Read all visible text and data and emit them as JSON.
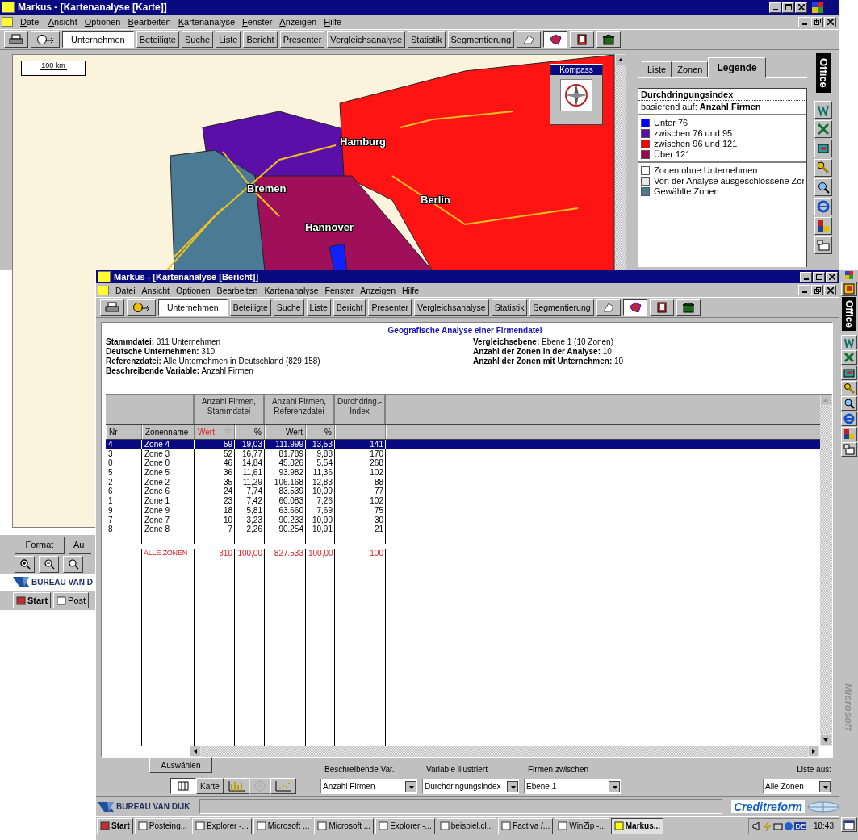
{
  "back_window": {
    "title": "Markus - [Kartenanalyse [Karte]]",
    "menu": [
      "Datei",
      "Ansicht",
      "Optionen",
      "Bearbeiten",
      "Kartenanalyse",
      "Fenster",
      "Anzeigen",
      "Hilfe"
    ],
    "toolbar": {
      "buttons": [
        {
          "label": "Unternehmen",
          "selected": true
        },
        {
          "label": "Beteiligte",
          "selected": false
        },
        {
          "label": "Suche",
          "selected": false
        },
        {
          "label": "Liste",
          "selected": false
        },
        {
          "label": "Bericht",
          "selected": false
        },
        {
          "label": "Presenter",
          "selected": false
        },
        {
          "label": "Vergleichsanalyse",
          "selected": false
        },
        {
          "label": "Statistik",
          "selected": false
        },
        {
          "label": "Segmentierung",
          "selected": false
        }
      ],
      "tools": [
        {
          "selected": false
        },
        {
          "selected": true
        },
        {
          "selected": false
        },
        {
          "selected": false
        }
      ]
    },
    "map": {
      "scale": "100 km",
      "compass": "Kompass",
      "cities": [
        "Hamburg",
        "Bremen",
        "Berlin",
        "Hannover"
      ]
    },
    "tabs": [
      {
        "label": "Liste",
        "selected": false
      },
      {
        "label": "Zonen",
        "selected": false
      },
      {
        "label": "Legende",
        "selected": true
      }
    ],
    "legend": {
      "title": "Durchdringungsindex",
      "basis_label": "basierend auf:",
      "basis_value": "Anzahl Firmen",
      "classes": [
        {
          "label": "Unter 76",
          "color": "#0000ff"
        },
        {
          "label": "zwischen 76 und 95",
          "color": "#5a10a8"
        },
        {
          "label": "zwischen 96 und 121",
          "color": "#ff0000"
        },
        {
          "label": "Über 121",
          "color": "#a00050"
        }
      ],
      "zones": [
        {
          "label": "Zonen ohne Unternehmen",
          "color": "#ffffff"
        },
        {
          "label": "Von der Analyse ausgeschlossene Zor",
          "color": "#e8e8e8"
        },
        {
          "label": "Gewählte Zonen",
          "color": "#4a7a94"
        }
      ]
    },
    "buttons": [
      "Format",
      "Au"
    ],
    "brand": "BUREAU VAN D",
    "taskbar": [
      "Start",
      "Post"
    ]
  },
  "office": {
    "label": "Office"
  },
  "front_window": {
    "title": "Markus - [Kartenanalyse [Bericht]]",
    "menu": [
      "Datei",
      "Ansicht",
      "Optionen",
      "Bearbeiten",
      "Kartenanalyse",
      "Fenster",
      "Anzeigen",
      "Hilfe"
    ],
    "toolbar": {
      "buttons": [
        {
          "label": "Unternehmen",
          "selected": true
        },
        {
          "label": "Beteiligte",
          "selected": false
        },
        {
          "label": "Suche",
          "selected": false
        },
        {
          "label": "Liste",
          "selected": false
        },
        {
          "label": "Bericht",
          "selected": false
        },
        {
          "label": "Presenter",
          "selected": false
        },
        {
          "label": "Vergleichsanalyse",
          "selected": false
        },
        {
          "label": "Statistik",
          "selected": false
        },
        {
          "label": "Segmentierung",
          "selected": false
        }
      ],
      "tools": [
        {
          "selected": false
        },
        {
          "selected": true
        },
        {
          "selected": false
        },
        {
          "selected": false
        }
      ]
    },
    "report": {
      "title": "Geografische Analyse einer Firmendatei",
      "left_info": [
        {
          "label": "Stammdatei:",
          "value": "311 Unternehmen"
        },
        {
          "label": "Deutsche Unternehmen:",
          "value": "310"
        },
        {
          "label": "Referenzdatei:",
          "value": "Alle Unternehmen in Deutschland  (829.158)"
        },
        {
          "label": "Beschreibende Variable:",
          "value": "Anzahl Firmen"
        }
      ],
      "right_info": [
        {
          "label": "Vergleichsebene:",
          "value": "Ebene 1 (10 Zonen)"
        },
        {
          "label": "Anzahl der Zonen in der Analyse:",
          "value": "10"
        },
        {
          "label": "Anzahl der Zonen mit Unternehmen:",
          "value": "10"
        }
      ]
    },
    "table": {
      "group_headers": [
        "Anzahl Firmen, Stammdatei",
        "Anzahl Firmen, Referenzdatei",
        "Durchdring.- Index"
      ],
      "columns": [
        {
          "label": "Nr",
          "sorted": false
        },
        {
          "label": "Zonenname",
          "sorted": false
        },
        {
          "label": "Wert",
          "sorted": true
        },
        {
          "label": "%",
          "sorted": false
        },
        {
          "label": "Wert",
          "sorted": false
        },
        {
          "label": "%",
          "sorted": false
        }
      ],
      "rows": [
        {
          "selected": true,
          "cells": [
            "4",
            "Zone 4",
            "59",
            "19,03",
            "111.999",
            "13,53",
            "141"
          ]
        },
        {
          "selected": false,
          "cells": [
            "3",
            "Zone 3",
            "52",
            "16,77",
            "81.789",
            "9,88",
            "170"
          ]
        },
        {
          "selected": false,
          "cells": [
            "0",
            "Zone 0",
            "46",
            "14,84",
            "45.826",
            "5,54",
            "268"
          ]
        },
        {
          "selected": false,
          "cells": [
            "5",
            "Zone 5",
            "36",
            "11,61",
            "93.982",
            "11,36",
            "102"
          ]
        },
        {
          "selected": false,
          "cells": [
            "2",
            "Zone 2",
            "35",
            "11,29",
            "106.168",
            "12,83",
            "88"
          ]
        },
        {
          "selected": false,
          "cells": [
            "6",
            "Zone 6",
            "24",
            "7,74",
            "83.539",
            "10,09",
            "77"
          ]
        },
        {
          "selected": false,
          "cells": [
            "1",
            "Zone 1",
            "23",
            "7,42",
            "60.083",
            "7,26",
            "102"
          ]
        },
        {
          "selected": false,
          "cells": [
            "9",
            "Zone 9",
            "18",
            "5,81",
            "63.660",
            "7,69",
            "75"
          ]
        },
        {
          "selected": false,
          "cells": [
            "7",
            "Zone 7",
            "10",
            "3,23",
            "90.233",
            "10,90",
            "30"
          ]
        },
        {
          "selected": false,
          "cells": [
            "8",
            "Zone 8",
            "7",
            "2,26",
            "90.254",
            "10,91",
            "21"
          ]
        }
      ],
      "total": {
        "label": "ALLE ZONEN",
        "cells": [
          "310",
          "100,00",
          "827.533",
          "100,00",
          "100"
        ]
      }
    },
    "controls": {
      "select_button": "Auswählen",
      "views": [
        {
          "kind": "table",
          "selected": true
        },
        {
          "kind": "text",
          "label": "Karte",
          "selected": false
        },
        {
          "kind": "bars",
          "selected": false
        },
        {
          "kind": "pie",
          "selected": false,
          "disabled": true
        },
        {
          "kind": "scatter",
          "selected": false
        }
      ],
      "dropdowns": [
        {
          "label": "Beschreibende Var.",
          "value": "Anzahl Firmen"
        },
        {
          "label": "Variable illustriert",
          "value": "Durchdringungsindex"
        },
        {
          "label": "Firmen zwischen",
          "value": "Ebene 1"
        }
      ],
      "list": {
        "label": "Liste aus:",
        "value": "Alle Zonen"
      }
    },
    "brand": "BUREAU VAN DIJK",
    "partner": "Creditreform",
    "taskbar": [
      {
        "label": "Start",
        "kind": "start",
        "selected": false
      },
      {
        "label": "Posteing...",
        "kind": "app",
        "selected": false
      },
      {
        "label": "Explorer -...",
        "kind": "app",
        "selected": false
      },
      {
        "label": "Microsoft ...",
        "kind": "app",
        "selected": false
      },
      {
        "label": "Microsoft ...",
        "kind": "app",
        "selected": false
      },
      {
        "label": "Explorer -...",
        "kind": "app",
        "selected": false
      },
      {
        "label": "beispiel.cl...",
        "kind": "app",
        "selected": false
      },
      {
        "label": "Factiva /...",
        "kind": "app",
        "selected": false
      },
      {
        "label": "WinZip -...",
        "kind": "app",
        "selected": false
      },
      {
        "label": "Markus...",
        "kind": "app",
        "selected": true
      }
    ],
    "tray": {
      "language": "DE",
      "clock": "18:43"
    }
  },
  "office_side": {
    "label": "Office",
    "vendor": "Microsoft"
  }
}
